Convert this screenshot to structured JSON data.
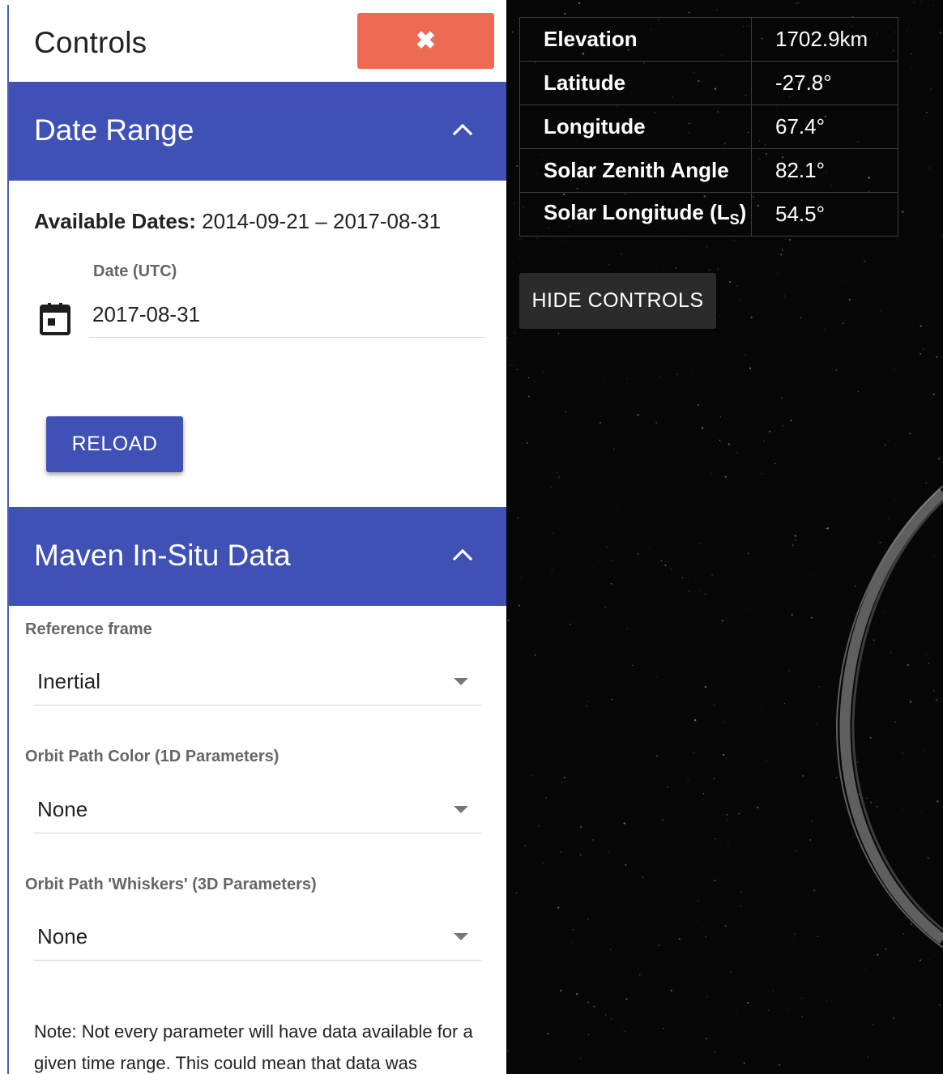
{
  "controls": {
    "title": "Controls",
    "close_symbol": "✖"
  },
  "date_range": {
    "header": "Date Range",
    "available_label": "Available Dates:",
    "available_value": "2014-09-21 – 2017-08-31",
    "date_label": "Date (UTC)",
    "date_value": "2017-08-31",
    "reload_label": "RELOAD"
  },
  "maven": {
    "header": "Maven In-Situ Data",
    "reference_frame_label": "Reference frame",
    "reference_frame_value": "Inertial",
    "orbit_color_label": "Orbit Path Color (1D Parameters)",
    "orbit_color_value": "None",
    "whiskers_label": "Orbit Path 'Whiskers' (3D Parameters)",
    "whiskers_value": "None",
    "note": "Note: Not every parameter will have data available for a given time range. This could mean that data was"
  },
  "info": {
    "rows": [
      {
        "key": "Elevation",
        "value": "1702.9km"
      },
      {
        "key": "Latitude",
        "value": "-27.8°"
      },
      {
        "key": "Longitude",
        "value": "67.4°"
      },
      {
        "key": "Solar Zenith Angle",
        "value": "82.1°"
      },
      {
        "key_main": "Solar Longitude (L",
        "key_sub": "S",
        "key_end": ")",
        "value": "54.5°"
      }
    ],
    "hide_controls_label": "HIDE CONTROLS"
  },
  "colors": {
    "primary": "#3f51b5",
    "close": "#ee6a52",
    "space": "#070707"
  },
  "icons": [
    "close-icon",
    "chevron-up-icon",
    "calendar-icon",
    "dropdown-caret-icon"
  ]
}
